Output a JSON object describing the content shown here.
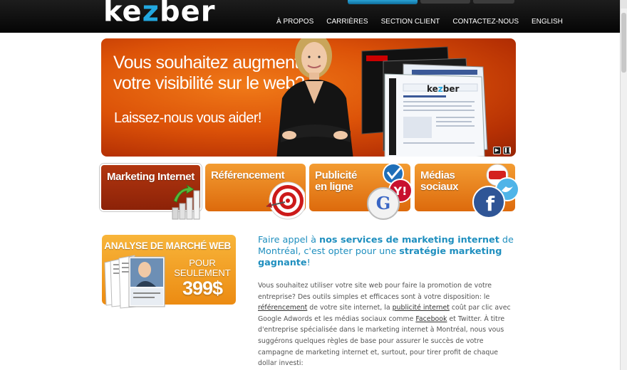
{
  "brand": {
    "logo_pre": "ke",
    "logo_z": "z",
    "logo_post": "ber",
    "logo_tm": "TM",
    "accent": "#22a8e0",
    "orange": "#e8700c",
    "dark_red": "#9a2a0a"
  },
  "nav": {
    "items": [
      "À PROPOS",
      "CARRIÈRES",
      "SECTION CLIENT",
      "CONTACTEZ-NOUS",
      "ENGLISH"
    ]
  },
  "hero": {
    "line1": "Vous souhaitez augmenter",
    "line2": "votre visibilité sur le web?",
    "line3": "Laissez-nous vous aider!",
    "slide_logo_pre": "ke",
    "slide_logo_z": "z",
    "slide_logo_post": "ber",
    "controls": {
      "play_icon": "play-icon",
      "pause_icon": "pause-icon"
    }
  },
  "tabs": [
    {
      "label": "Marketing Internet",
      "icon": "bar-chart-arrow-icon",
      "active": true
    },
    {
      "label": "Référencement",
      "icon": "target-icon",
      "active": false
    },
    {
      "label_l1": "Publicité",
      "label_l2": "en ligne",
      "icon": "search-engines-icon",
      "active": false
    },
    {
      "label_l1": "Médias",
      "label_l2": "sociaux",
      "icon": "social-media-icon",
      "active": false
    }
  ],
  "promo": {
    "title": "ANALYSE DE MARCHÉ WEB",
    "pour": "POUR",
    "seulement": "SEULEMENT",
    "price": "399$"
  },
  "article": {
    "headline_1": "Faire appel à ",
    "headline_2": "nos services de marketing internet",
    "headline_3": " de Montréal, c'est opter pour une ",
    "headline_4": "stratégie marketing gagnante",
    "headline_5": "!",
    "body_1": "Vous souhaitez utiliser votre site web pour faire la promotion de votre entreprise? Des outils simples et efficaces sont à votre disposition: le ",
    "link_referencement": "référencement",
    "body_2": " de votre site internet, la ",
    "link_publicite": "publicité internet",
    "body_3": " coût par clic avec Google Adwords et les médias sociaux comme ",
    "link_facebook": "Facebook",
    "body_4": " et Twitter. À titre d'entreprise spécialisée dans le marketing internet à Montréal, nous vous suggérons quelques règles de base pour assurer le succès de votre campagne de marketing internet et, surtout, pour tirer profit de chaque dollar investi:"
  }
}
